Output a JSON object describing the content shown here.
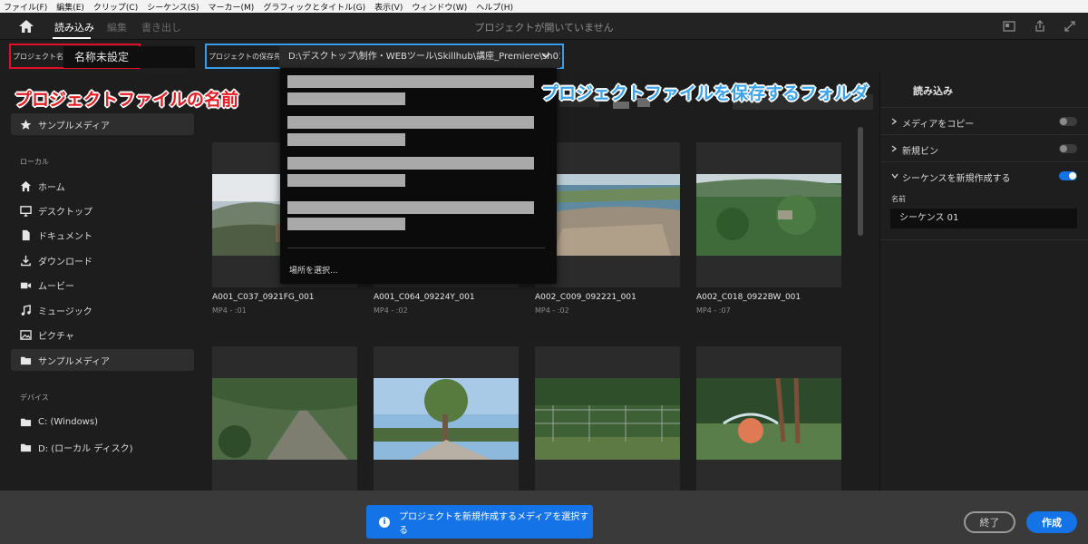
{
  "menubar": [
    "ファイル(F)",
    "編集(E)",
    "クリップ(C)",
    "シーケンス(S)",
    "マーカー(M)",
    "グラフィックとタイトル(G)",
    "表示(V)",
    "ウィンドウ(W)",
    "ヘルプ(H)"
  ],
  "header": {
    "tabs": [
      "読み込み",
      "編集",
      "書き出し"
    ],
    "active_tab": "読み込み",
    "window_title": "プロジェクトが開いていません"
  },
  "project": {
    "name_label": "プロジェクト名",
    "name_value": "名称未設定",
    "location_label": "プロジェクトの保存先",
    "location_value": "D:\\デスクトップ\\制作・WEBツール\\Skillhub\\講座_Premiere\\sh01..."
  },
  "annotations": {
    "red": "プロジェクトファイルの名前",
    "blue": "プロジェクトファイルを保存するフォルダ"
  },
  "dropdown": {
    "choose_location": "場所を選択..."
  },
  "sidebar": {
    "top_item": "サンプルメディア",
    "local_heading": "ローカル",
    "local_items": [
      {
        "label": "ホーム",
        "icon": "home-icon"
      },
      {
        "label": "デスクトップ",
        "icon": "monitor-icon"
      },
      {
        "label": "ドキュメント",
        "icon": "document-icon"
      },
      {
        "label": "ダウンロード",
        "icon": "download-icon"
      },
      {
        "label": "ムービー",
        "icon": "video-icon"
      },
      {
        "label": "ミュージック",
        "icon": "music-icon"
      },
      {
        "label": "ピクチャ",
        "icon": "picture-icon"
      },
      {
        "label": "サンプルメディア",
        "icon": "folder-icon"
      }
    ],
    "devices_heading": "デバイス",
    "devices": [
      "C: (Windows)",
      "D: (ローカル ディスク)"
    ]
  },
  "clips": [
    {
      "name": "A001_C037_0921FG_001",
      "meta": "MP4 - :01"
    },
    {
      "name": "A001_C064_09224Y_001",
      "meta": "MP4 - :02"
    },
    {
      "name": "A002_C009_092221_001",
      "meta": "MP4 - :02"
    },
    {
      "name": "A002_C018_0922BW_001",
      "meta": "MP4 - :07"
    },
    {
      "name": "",
      "meta": ""
    },
    {
      "name": "",
      "meta": ""
    },
    {
      "name": "",
      "meta": ""
    },
    {
      "name": "",
      "meta": ""
    }
  ],
  "right_panel": {
    "title": "読み込み",
    "copy_media": "メディアをコピー",
    "new_bin": "新規ビン",
    "new_sequence": "シーケンスを新規作成する",
    "copy_media_on": false,
    "new_bin_on": false,
    "new_sequence_on": true,
    "name_label": "名前",
    "sequence_name": "シーケンス 01"
  },
  "footer": {
    "banner": "プロジェクトを新規作成するメディアを選択する",
    "exit": "終了",
    "create": "作成"
  },
  "colors": {
    "accent": "#1473e6",
    "annotation_red": "#e51c23",
    "annotation_blue": "#3aa3ec"
  }
}
